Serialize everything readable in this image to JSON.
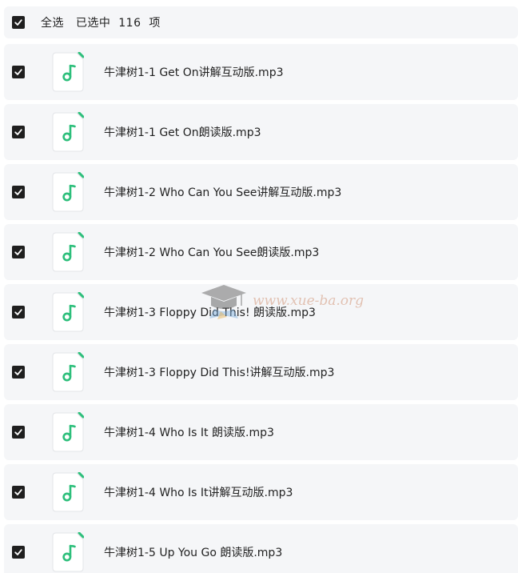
{
  "header": {
    "select_all_label": "全选",
    "selected_text": "已选中",
    "selected_count": "116",
    "unit": "项",
    "checked": true
  },
  "files": [
    {
      "name": "牛津树1-1 Get On讲解互动版.mp3",
      "checked": true
    },
    {
      "name": "牛津树1-1 Get On朗读版.mp3",
      "checked": true
    },
    {
      "name": "牛津树1-2 Who Can You See讲解互动版.mp3",
      "checked": true
    },
    {
      "name": "牛津树1-2 Who Can You See朗读版.mp3",
      "checked": true
    },
    {
      "name": "牛津树1-3 Floppy Did This! 朗读版.mp3",
      "checked": true
    },
    {
      "name": "牛津树1-3 Floppy Did This!讲解互动版.mp3",
      "checked": true
    },
    {
      "name": "牛津树1-4 Who Is It 朗读版.mp3",
      "checked": true
    },
    {
      "name": "牛津树1-4 Who Is It讲解互动版.mp3",
      "checked": true
    },
    {
      "name": "牛津树1-5 Up You Go 朗读版.mp3",
      "checked": true
    }
  ],
  "file_icon": "music-note-icon",
  "watermark": {
    "text": "www.xue-ba.org",
    "icon": "graduation-cap-icon"
  },
  "colors": {
    "row_background": "#f5f6f8",
    "checkbox": "#1f1f1f",
    "icon_accent": "#2dbf7b"
  }
}
